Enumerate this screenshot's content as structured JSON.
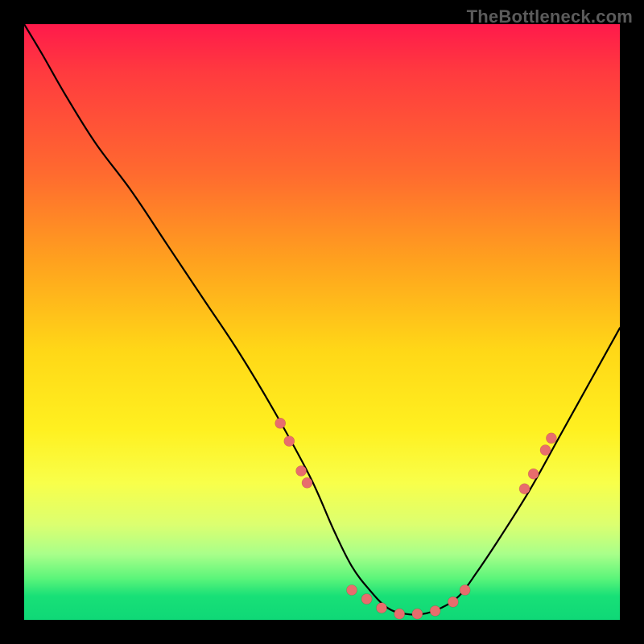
{
  "watermark": "TheBottleneck.com",
  "chart_data": {
    "type": "line",
    "title": "",
    "xlabel": "",
    "ylabel": "",
    "xlim": [
      0,
      100
    ],
    "ylim": [
      0,
      100
    ],
    "legend": false,
    "grid": false,
    "background_gradient": [
      "#ff1a4b",
      "#ff6a2f",
      "#ffd817",
      "#dcff70",
      "#0fd877"
    ],
    "series": [
      {
        "name": "bottleneck-curve",
        "x": [
          0,
          3,
          7,
          12,
          18,
          24,
          30,
          36,
          42,
          48,
          52,
          55,
          58,
          61,
          64,
          67,
          70,
          73,
          76,
          80,
          85,
          90,
          95,
          100
        ],
        "y": [
          100,
          95,
          88,
          80,
          72,
          63,
          54,
          45,
          35,
          24,
          15,
          9,
          5,
          2,
          1,
          1,
          2,
          4,
          8,
          14,
          22,
          31,
          40,
          49
        ]
      }
    ],
    "markers": {
      "name": "highlighted-points",
      "x": [
        43,
        44.5,
        46.5,
        47.5,
        55,
        57.5,
        60,
        63,
        66,
        69,
        72,
        74,
        84,
        85.5,
        87.5,
        88.5
      ],
      "y": [
        33,
        30,
        25,
        23,
        5,
        3.5,
        2,
        1,
        1,
        1.5,
        3,
        5,
        22,
        24.5,
        28.5,
        30.5
      ]
    }
  },
  "colors": {
    "curve": "#000000",
    "marker": "#e86d6d",
    "frame": "#000000"
  }
}
